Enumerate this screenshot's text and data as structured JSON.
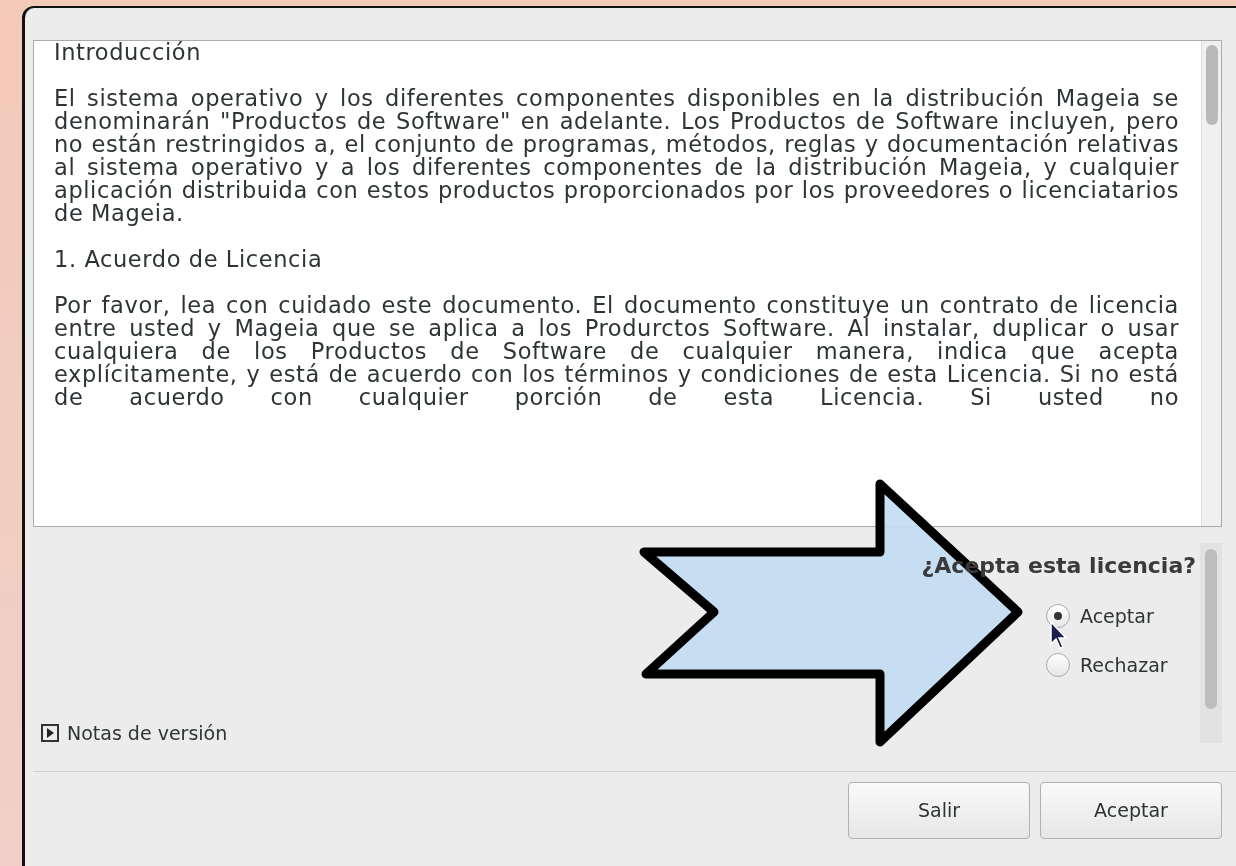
{
  "license": {
    "paragraphs": [
      "Introducción",
      "El sistema operativo y los diferentes componentes disponibles en la distribución Mageia se denominarán \"Productos de Software\" en adelante. Los Productos de Software incluyen, pero no están restringidos a, el conjunto de programas, métodos, reglas y documentación relativas al sistema operativo y a los diferentes componentes de la distribución Mageia, y cualquier aplicación distribuida con estos productos proporcionados por los proveedores o licenciatarios de Mageia.",
      "1. Acuerdo de Licencia",
      "Por favor, lea con cuidado este documento. El documento constituye un contrato de licencia entre usted y Mageia que se aplica a los Produrctos Software. Al instalar, duplicar o usar cualquiera de los Productos de Software de cualquier manera, indica que acepta explícitamente, y está de acuerdo con los términos y condiciones de esta Licencia. Si no está de acuerdo con cualquier porción de esta Licencia. Si usted no"
    ]
  },
  "question": "¿Acepta esta licencia?",
  "options": [
    {
      "label": "Aceptar",
      "selected": true
    },
    {
      "label": "Rechazar",
      "selected": false
    }
  ],
  "expander": {
    "label": "Notas de versión",
    "expanded": false
  },
  "buttons": [
    "Salir",
    "Aceptar"
  ]
}
